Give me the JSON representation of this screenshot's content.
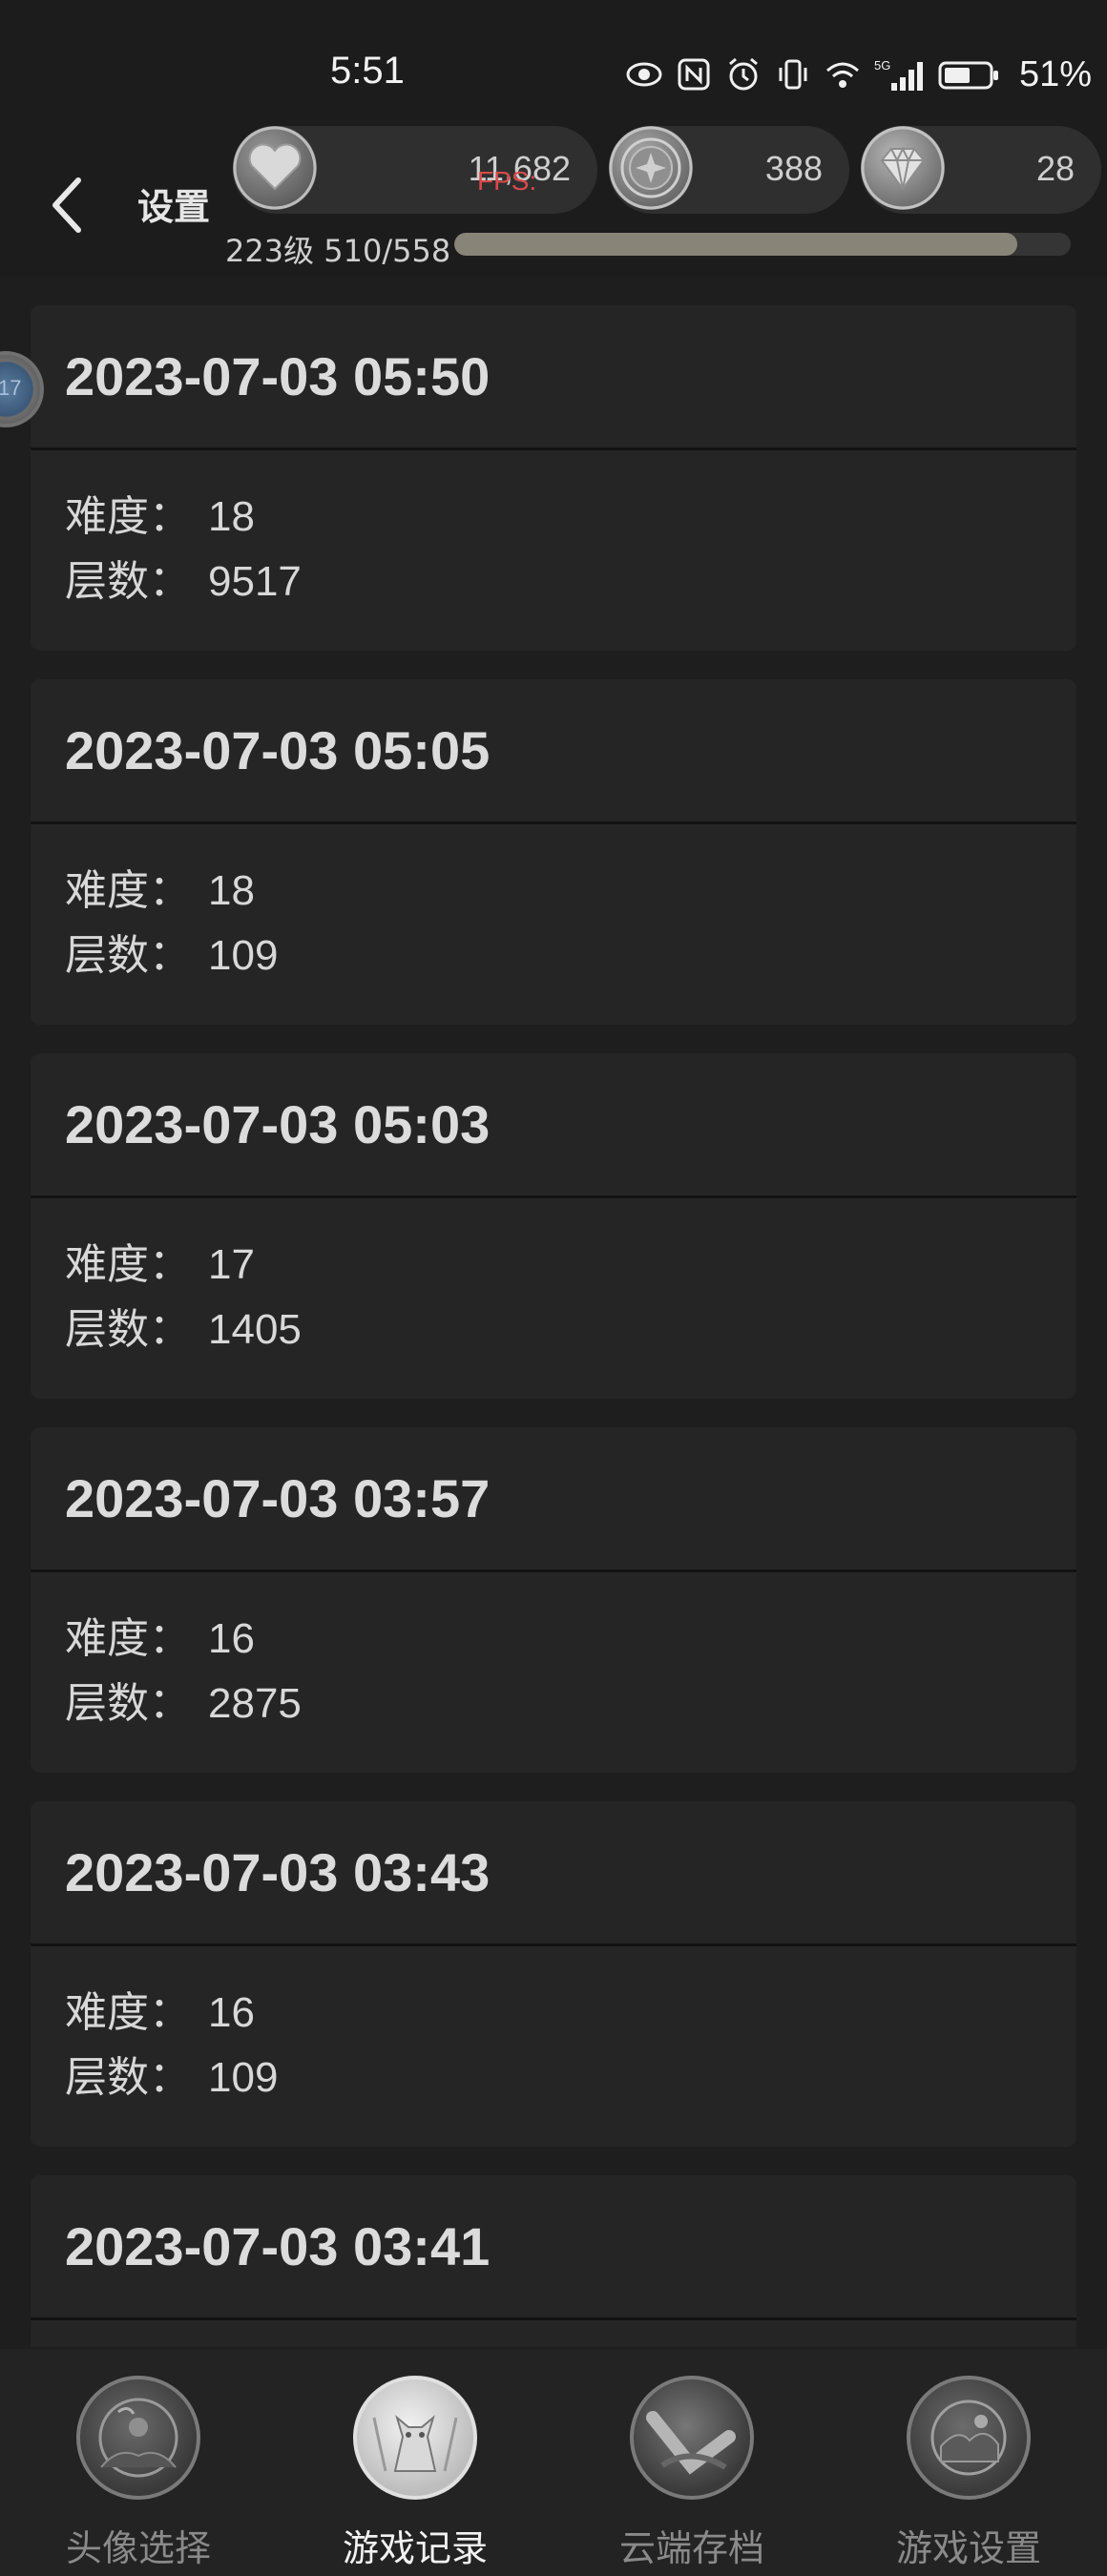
{
  "status_bar": {
    "time": "5:51",
    "battery": "51%",
    "network": "5G"
  },
  "header": {
    "title": "设置",
    "resources": [
      {
        "icon": "heart-icon",
        "value": "11,682"
      },
      {
        "icon": "coin-icon",
        "value": "388"
      },
      {
        "icon": "diamond-icon",
        "value": "28"
      }
    ],
    "fps_overlay": "FPS:",
    "level_text": "223级 510/558",
    "xp_fraction": 0.914
  },
  "records": [
    {
      "datetime": "2023-07-03 05:50",
      "difficulty_label": "难度：",
      "difficulty": "18",
      "floors_label": "层数：",
      "floors": "9517"
    },
    {
      "datetime": "2023-07-03 05:05",
      "difficulty_label": "难度：",
      "difficulty": "18",
      "floors_label": "层数：",
      "floors": "109"
    },
    {
      "datetime": "2023-07-03 05:03",
      "difficulty_label": "难度：",
      "difficulty": "17",
      "floors_label": "层数：",
      "floors": "1405"
    },
    {
      "datetime": "2023-07-03 03:57",
      "difficulty_label": "难度：",
      "difficulty": "16",
      "floors_label": "层数：",
      "floors": "2875"
    },
    {
      "datetime": "2023-07-03 03:43",
      "difficulty_label": "难度：",
      "difficulty": "16",
      "floors_label": "层数：",
      "floors": "109"
    },
    {
      "datetime": "2023-07-03 03:41",
      "difficulty_label": "",
      "difficulty": "",
      "floors_label": "",
      "floors": ""
    }
  ],
  "side_avatar_level": "17",
  "bottom_nav": [
    {
      "label": "头像选择",
      "icon": "avatar-select-icon",
      "active": false
    },
    {
      "label": "游戏记录",
      "icon": "game-record-icon",
      "active": true
    },
    {
      "label": "云端存档",
      "icon": "cloud-save-icon",
      "active": false
    },
    {
      "label": "游戏设置",
      "icon": "game-settings-icon",
      "active": false
    }
  ],
  "colors": {
    "background": "#1e1e1e",
    "card": "#252525",
    "xp_fill": "#888478",
    "fps_text": "#d94a4a"
  }
}
